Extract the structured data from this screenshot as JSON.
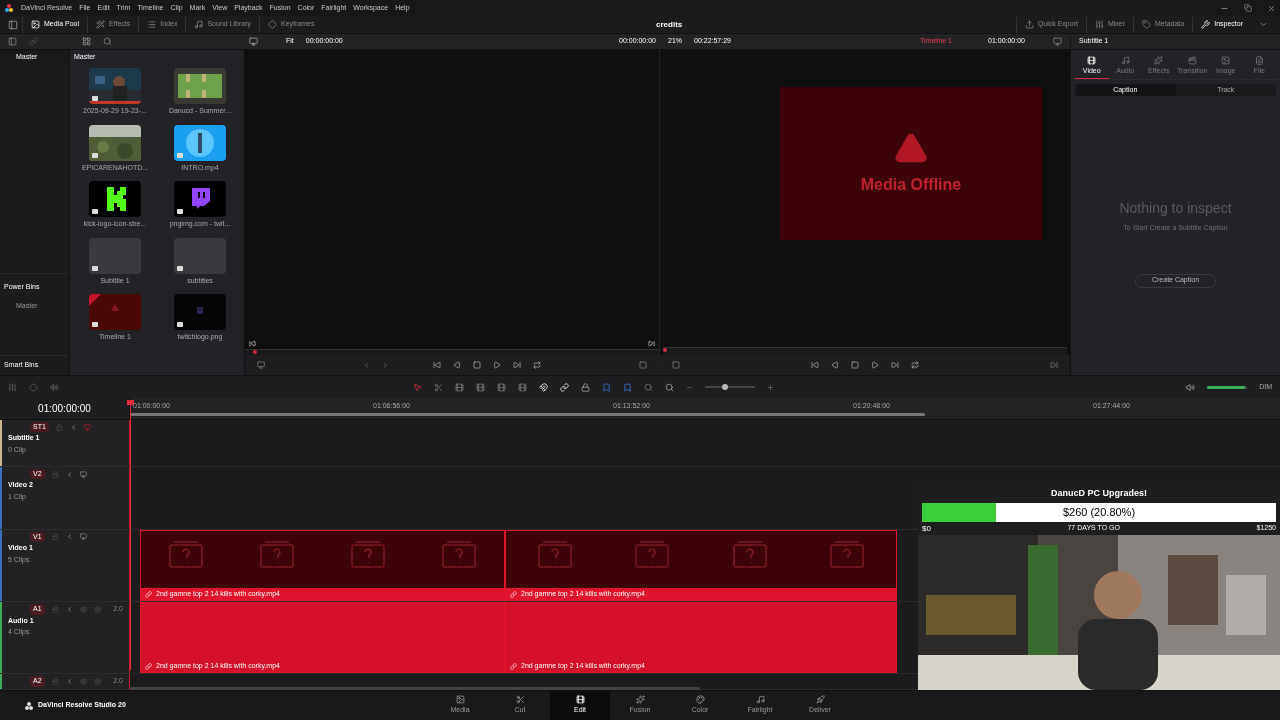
{
  "menu_bar": {
    "app": "DaVinci Resolve",
    "items": [
      "File",
      "Edit",
      "Trim",
      "Timeline",
      "Clip",
      "Mark",
      "View",
      "Playback",
      "Fusion",
      "Color",
      "Fairlight",
      "Workspace",
      "Help"
    ]
  },
  "toolbar": {
    "left": [
      {
        "label": "Media Pool",
        "selected": true
      },
      {
        "label": "Effects",
        "selected": false
      },
      {
        "label": "Index",
        "selected": false
      },
      {
        "label": "Sound Library",
        "selected": false
      },
      {
        "label": "Keyframes",
        "selected": false
      }
    ],
    "title": "credits",
    "right": [
      {
        "label": "Quick Export",
        "selected": false
      },
      {
        "label": "Mixer",
        "selected": false
      },
      {
        "label": "Metadata",
        "selected": false
      },
      {
        "label": "Inspector",
        "selected": true
      }
    ]
  },
  "viewer_bar": {
    "source_zoom": "Fit",
    "source_timecode": "00:00:00:00",
    "program_timecode": "00:00:00:00",
    "zoom": "21%",
    "duration": "00:22:57:29",
    "timeline_name": "Timeline 1",
    "timeline_timecode": "01:00:00:00",
    "inspector_title": "Subtitle 1"
  },
  "bins": {
    "header": "Master",
    "power_bins": "Power Bins",
    "power_items": [
      "Master"
    ],
    "smart_bins": "Smart Bins"
  },
  "media_pool": {
    "header": "Master",
    "clips": [
      {
        "name": "2025-09-29 19-23-...",
        "kind": "picture"
      },
      {
        "name": "Danucd - Summer...",
        "kind": "bars"
      },
      {
        "name": "EPICARENAHOTD...",
        "kind": "landscape"
      },
      {
        "name": "INTRO.mp4",
        "kind": "blue"
      },
      {
        "name": "kick-logo-icon-stre...",
        "kind": "kick"
      },
      {
        "name": "pngimg.com - twit...",
        "kind": "twitch"
      },
      {
        "name": "Subtitle 1",
        "kind": "blank"
      },
      {
        "name": "subtitles",
        "kind": "blank"
      },
      {
        "name": "Timeline 1",
        "kind": "timeline"
      },
      {
        "name": "twitchlogo.png",
        "kind": "dark"
      }
    ]
  },
  "program_viewer": {
    "message": "Media Offline"
  },
  "inspector": {
    "tabs": [
      {
        "label": "Video",
        "selected": true,
        "disabled": false
      },
      {
        "label": "Audio",
        "selected": false,
        "disabled": true
      },
      {
        "label": "Effects",
        "selected": false,
        "disabled": true
      },
      {
        "label": "Transition",
        "selected": false,
        "disabled": true
      },
      {
        "label": "Image",
        "selected": false,
        "disabled": true
      },
      {
        "label": "File",
        "selected": false,
        "disabled": true
      }
    ],
    "subtabs": [
      {
        "label": "Caption",
        "selected": true
      },
      {
        "label": "Track",
        "selected": false
      }
    ],
    "empty_title": "Nothing to inspect",
    "empty_hint": "To Start Create a Subtitle Caption",
    "button": "Create Caption"
  },
  "timeline": {
    "timecode": "01:00:00:00",
    "ruler": [
      "01:00:00:00",
      "01:06:56:00",
      "01:13:52:00",
      "01:20:48:00",
      "01:27:44:00"
    ],
    "volume_label": "DIM",
    "zoom_slider": {
      "level": 0.4
    },
    "volume_slider": {
      "level": 0.95
    },
    "tracks": [
      {
        "id": "ST1",
        "kind": "subtitle",
        "name": "Subtitle 1",
        "count": "0 Clip",
        "color": "#c8b68a"
      },
      {
        "id": "V2",
        "kind": "video",
        "name": "Video 2",
        "count": "1 Clip",
        "color": "#3b6fb6"
      },
      {
        "id": "V1",
        "kind": "video",
        "name": "Video 1",
        "count": "5 Clips",
        "color": "#3b6fb6",
        "clips": [
          "2nd gamne top 2 14 kills with corky.mp4",
          "2nd gamne top 2 14 kills with corky.mp4"
        ]
      },
      {
        "id": "A1",
        "kind": "audio",
        "name": "Audio 1",
        "count": "4 Clips",
        "color": "#3fae5a",
        "channels": "2.0",
        "clips": [
          "2nd gamne top 2 14 kills with corky.mp4",
          "2nd gamne top 2 14 kills with corky.mp4"
        ]
      },
      {
        "id": "A2",
        "kind": "audio",
        "color": "#3fae5a",
        "channels": "2.0"
      }
    ]
  },
  "overlay": {
    "title": "DanucD PC Upgrades!",
    "amount": "$260 (20.80%)",
    "level": 0.208,
    "start": "$0",
    "days": "77 DAYS TO GO",
    "goal": "$1250"
  },
  "product": "DaVinci Resolve Studio 20",
  "pages": [
    {
      "label": "Media",
      "selected": false
    },
    {
      "label": "Cut",
      "selected": false
    },
    {
      "label": "Edit",
      "selected": true
    },
    {
      "label": "Fusion",
      "selected": false
    },
    {
      "label": "Color",
      "selected": false
    },
    {
      "label": "Fairlight",
      "selected": false
    },
    {
      "label": "Deliver",
      "selected": false
    }
  ]
}
